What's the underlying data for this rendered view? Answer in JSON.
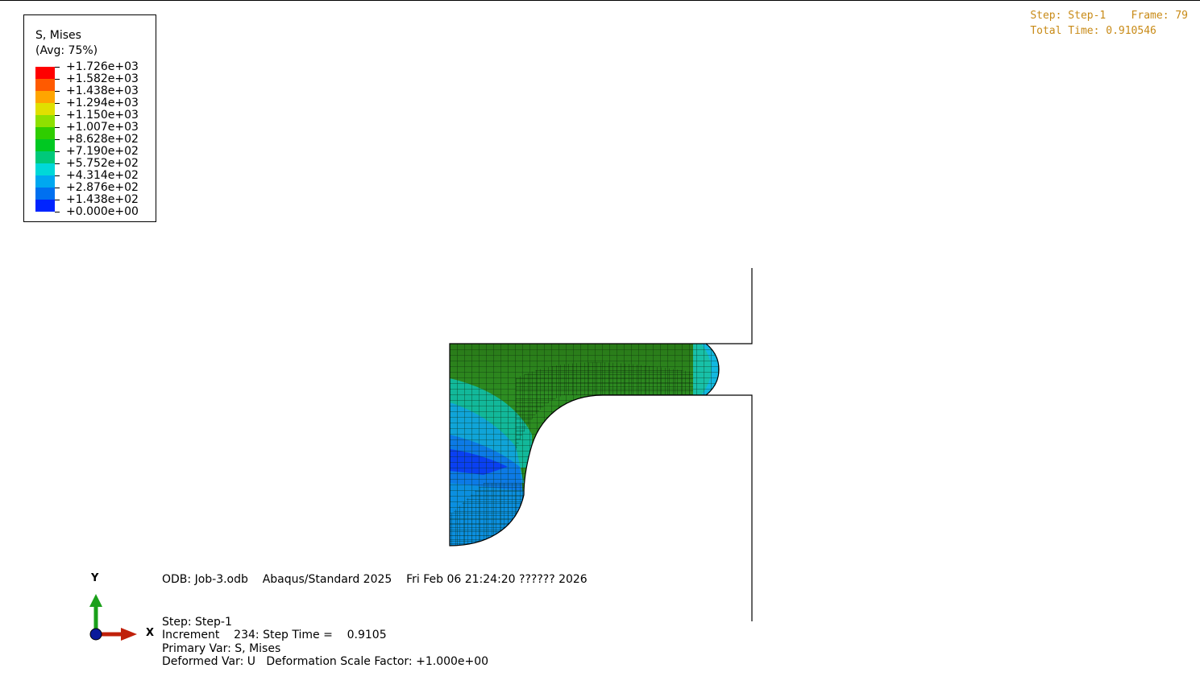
{
  "legend": {
    "variable": "S, Mises",
    "averaging": "(Avg: 75%)",
    "levels": [
      "+1.726e+03",
      "+1.582e+03",
      "+1.438e+03",
      "+1.294e+03",
      "+1.150e+03",
      "+1.007e+03",
      "+8.628e+02",
      "+7.190e+02",
      "+5.752e+02",
      "+4.314e+02",
      "+2.876e+02",
      "+1.438e+02",
      "+0.000e+00"
    ],
    "colors": [
      "#ff0000",
      "#ff5a00",
      "#ffa500",
      "#e0e000",
      "#8ee000",
      "#2fcd00",
      "#00c822",
      "#00c97a",
      "#00d8d8",
      "#00a8f0",
      "#0070f0",
      "#0024ff"
    ]
  },
  "frame": {
    "step_line": "Step: Step-1    Frame: 79",
    "time_line": "Total Time: 0.910546"
  },
  "info": {
    "odb_line": "ODB: Job-3.odb    Abaqus/Standard 2025    Fri Feb 06 21:24:20 ?????? 2026",
    "step_line": "Step: Step-1",
    "increment_line": "Increment    234: Step Time =    0.9105",
    "primary_var_line": "Primary Var: S, Mises",
    "deformed_var_line": "Deformed Var: U   Deformation Scale Factor: +1.000e+00"
  },
  "triad": {
    "x_label": "X",
    "y_label": "Y",
    "x_color": "#c0200a",
    "y_color": "#1aa01a",
    "origin_color": "#0a1a9a"
  }
}
